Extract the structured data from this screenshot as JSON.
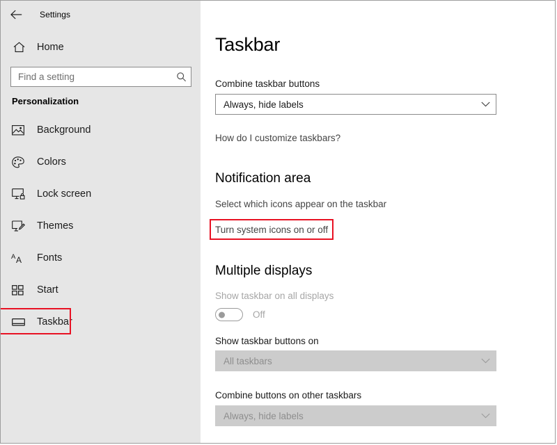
{
  "window": {
    "app_title": "Settings",
    "back_icon": "back-arrow-icon"
  },
  "sidebar": {
    "home": {
      "label": "Home",
      "icon": "home-icon"
    },
    "search": {
      "value": "",
      "placeholder": "Find a setting",
      "icon": "search-icon"
    },
    "section_title": "Personalization",
    "items": [
      {
        "label": "Background",
        "icon": "picture-icon",
        "selected": false,
        "highlighted": false
      },
      {
        "label": "Colors",
        "icon": "palette-icon",
        "selected": false,
        "highlighted": false
      },
      {
        "label": "Lock screen",
        "icon": "lock-screen-icon",
        "selected": false,
        "highlighted": false
      },
      {
        "label": "Themes",
        "icon": "theme-brush-icon",
        "selected": false,
        "highlighted": false
      },
      {
        "label": "Fonts",
        "icon": "fonts-aa-icon",
        "selected": false,
        "highlighted": false
      },
      {
        "label": "Start",
        "icon": "start-tiles-icon",
        "selected": false,
        "highlighted": false
      },
      {
        "label": "Taskbar",
        "icon": "taskbar-icon",
        "selected": true,
        "highlighted": true
      }
    ]
  },
  "main": {
    "page_title": "Taskbar",
    "combine_taskbar_buttons": {
      "label": "Combine taskbar buttons",
      "value": "Always, hide labels",
      "chevron": "chevron-down-icon"
    },
    "customize_link": "How do I customize taskbars?",
    "notification_area": {
      "heading": "Notification area",
      "link_select_icons": "Select which icons appear on the taskbar",
      "link_system_icons": "Turn system icons on or off"
    },
    "multiple_displays": {
      "heading": "Multiple displays",
      "show_on_all": {
        "label": "Show taskbar on all displays",
        "state": "Off",
        "enabled": false
      },
      "show_buttons_on": {
        "label": "Show taskbar buttons on",
        "value": "All taskbars",
        "enabled": false,
        "chevron": "chevron-down-icon"
      },
      "combine_other": {
        "label": "Combine buttons on other taskbars",
        "value": "Always, hide labels",
        "enabled": false,
        "chevron": "chevron-down-icon"
      }
    }
  },
  "colors": {
    "sidebar_bg": "#e6e6e6",
    "main_bg": "#ffffff",
    "highlight_red": "#e81123",
    "disabled_text": "#a6a6a6",
    "disabled_field_bg": "#cccccc"
  }
}
